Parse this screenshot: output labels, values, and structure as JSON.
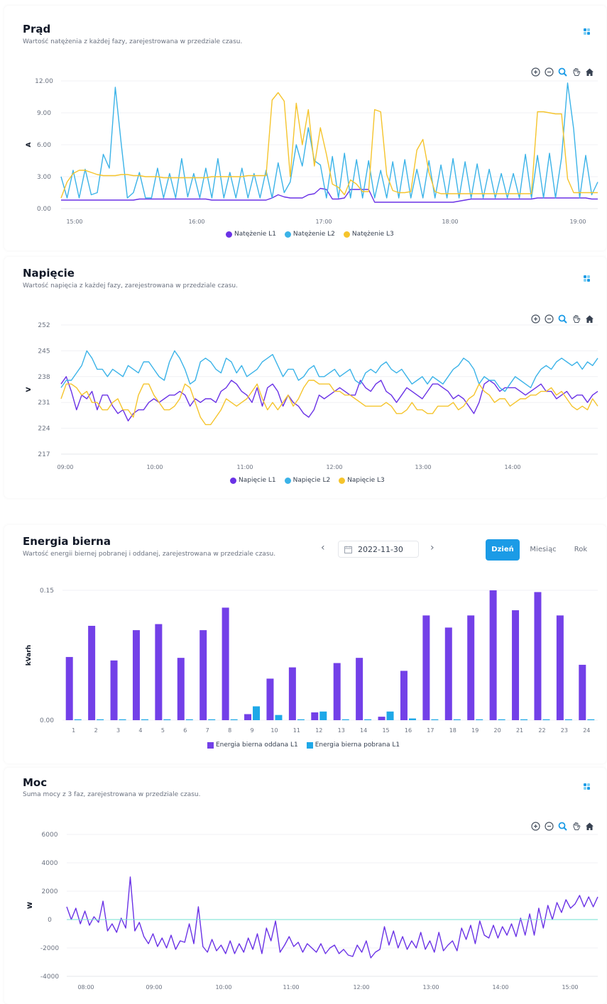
{
  "colors": {
    "l1": "#6a32e6",
    "l2": "#3bb3e8",
    "l3": "#f5c42c",
    "bar_out": "#7340e8",
    "bar_in": "#1ea8e8",
    "zero": "#6fe0d0",
    "accent": "#1b9be6"
  },
  "current": {
    "title": "Prąd",
    "subtitle": "Wartość natężenia z każdej fazy, zarejestrowana w przedziale czasu.",
    "legend": [
      "Natężenie L1",
      "Natężenie L2",
      "Natężenie L3"
    ]
  },
  "voltage": {
    "title": "Napięcie",
    "subtitle": "Wartość napięcia z każdej fazy, zarejestrowana w przedziale czasu.",
    "legend": [
      "Napięcie L1",
      "Napięcie L2",
      "Napięcie L3"
    ]
  },
  "reactive": {
    "title": "Energia bierna",
    "subtitle": "Wartość energii biernej pobranej i oddanej, zarejestrowana w przedziale czasu.",
    "date": "2022-11-30",
    "tabs": [
      "Dzień",
      "Miesiąc",
      "Rok"
    ],
    "legend": [
      "Energia bierna oddana L1",
      "Energia bierna pobrana L1"
    ]
  },
  "power": {
    "title": "Moc",
    "subtitle": "Suma mocy z 3 faz, zarejestrowana w przedziale czasu."
  },
  "toolbar_icons": [
    "zoom-in-icon",
    "zoom-out-icon",
    "magnify-icon",
    "pan-hand-icon",
    "home-icon"
  ],
  "chart_data": [
    {
      "type": "line",
      "ylabel": "A",
      "ylim": [
        0,
        12
      ],
      "yticks": [
        "12.00",
        "9.00",
        "6.00",
        "3.00",
        "0.00"
      ],
      "xticks": [
        "15:00",
        "16:00",
        "17:00",
        "18:00",
        "19:00"
      ],
      "x_range": [
        "14:52",
        "19:10"
      ],
      "series": [
        {
          "name": "Natężenie L1",
          "color": "#6a32e6",
          "values": [
            0.8,
            0.8,
            0.8,
            0.8,
            0.8,
            0.8,
            0.8,
            0.8,
            0.8,
            0.8,
            0.8,
            0.8,
            0.8,
            0.9,
            0.9,
            0.9,
            0.9,
            0.9,
            0.9,
            0.9,
            0.9,
            0.9,
            0.9,
            0.9,
            0.9,
            0.8,
            0.8,
            0.8,
            0.8,
            0.8,
            0.8,
            0.8,
            0.8,
            0.8,
            0.8,
            1.0,
            1.3,
            1.1,
            1.0,
            1.0,
            1.0,
            1.3,
            1.4,
            1.9,
            1.8,
            0.9,
            0.9,
            1.0,
            1.8,
            1.8,
            1.8,
            1.8,
            0.6,
            0.6,
            0.6,
            0.6,
            0.6,
            0.6,
            0.6,
            0.6,
            0.6,
            0.6,
            0.6,
            0.6,
            0.6,
            0.6,
            0.7,
            0.8,
            0.9,
            0.9,
            0.9,
            0.9,
            0.9,
            0.9,
            0.9,
            0.9,
            0.9,
            0.9,
            0.9,
            1.0,
            1.0,
            1.0,
            1.0,
            1.0,
            1.0,
            1.0,
            1.0,
            1.0,
            0.9,
            0.9
          ]
        },
        {
          "name": "Natężenie L2",
          "color": "#3bb3e8",
          "values": [
            3.0,
            1.0,
            3.6,
            1.0,
            3.7,
            1.3,
            1.5,
            5.1,
            3.8,
            11.4,
            6.0,
            1.0,
            1.5,
            3.4,
            1.0,
            1.0,
            3.8,
            1.0,
            3.3,
            1.0,
            4.7,
            1.1,
            3.3,
            1.0,
            3.8,
            1.0,
            4.7,
            1.0,
            3.4,
            1.0,
            3.8,
            1.0,
            3.3,
            1.0,
            3.6,
            1.0,
            4.3,
            1.5,
            2.5,
            6.0,
            4.0,
            7.6,
            4.5,
            4.1,
            1.0,
            4.9,
            1.0,
            5.2,
            1.0,
            4.6,
            1.0,
            4.5,
            1.0,
            3.6,
            1.0,
            4.4,
            1.0,
            4.6,
            1.0,
            3.7,
            1.0,
            4.5,
            1.0,
            4.1,
            1.0,
            4.7,
            1.0,
            4.4,
            1.0,
            4.2,
            1.0,
            3.7,
            1.0,
            3.3,
            1.0,
            3.3,
            1.0,
            5.1,
            1.0,
            5.0,
            1.0,
            5.2,
            1.0,
            4.8,
            11.8,
            7.5,
            1.0,
            5.0,
            1.3,
            2.5
          ]
        },
        {
          "name": "Natężenie L3",
          "color": "#f5c42c",
          "values": [
            1.0,
            2.5,
            3.3,
            3.6,
            3.6,
            3.4,
            3.2,
            3.1,
            3.1,
            3.1,
            3.2,
            3.2,
            3.1,
            3.1,
            3.0,
            3.0,
            3.0,
            2.9,
            2.9,
            2.9,
            2.9,
            2.9,
            2.9,
            2.9,
            2.9,
            3.0,
            3.0,
            3.0,
            3.0,
            3.0,
            3.0,
            3.1,
            3.1,
            3.1,
            3.1,
            10.2,
            10.9,
            10.1,
            3.0,
            9.9,
            6.0,
            9.3,
            4.0,
            7.6,
            5.1,
            2.3,
            2.0,
            1.3,
            2.7,
            2.3,
            1.6,
            1.6,
            9.3,
            9.1,
            3.2,
            1.7,
            1.5,
            1.5,
            1.6,
            5.5,
            6.5,
            3.4,
            1.6,
            1.4,
            1.4,
            1.4,
            1.4,
            1.4,
            1.4,
            1.4,
            1.4,
            1.4,
            1.4,
            1.4,
            1.4,
            1.4,
            1.4,
            1.4,
            1.4,
            9.1,
            9.1,
            9.0,
            8.9,
            8.9,
            2.8,
            1.5,
            1.5,
            1.5,
            1.5,
            1.5
          ]
        }
      ]
    },
    {
      "type": "line",
      "ylabel": "V",
      "ylim": [
        217,
        252
      ],
      "yticks": [
        "252",
        "245",
        "238",
        "231",
        "224",
        "217"
      ],
      "xticks": [
        "09:00",
        "10:00",
        "11:00",
        "12:00",
        "13:00",
        "14:00"
      ],
      "x_range": [
        "08:53",
        "14:55"
      ],
      "series": [
        {
          "name": "Napięcie L1",
          "color": "#6a32e6",
          "values": [
            236,
            238,
            234,
            229,
            233,
            232,
            234,
            229,
            233,
            233,
            230,
            228,
            229,
            226,
            228,
            229,
            229,
            231,
            232,
            231,
            232,
            233,
            233,
            234,
            233,
            230,
            232,
            231,
            232,
            232,
            231,
            234,
            235,
            237,
            236,
            234,
            233,
            231,
            235,
            230,
            235,
            236,
            234,
            230,
            233,
            231,
            230,
            228,
            227,
            229,
            233,
            232,
            233,
            234,
            235,
            234,
            233,
            233,
            237,
            235,
            234,
            236,
            237,
            234,
            233,
            231,
            233,
            235,
            234,
            233,
            232,
            234,
            236,
            236,
            235,
            234,
            232,
            233,
            232,
            230,
            228,
            231,
            236,
            237,
            236,
            234,
            235,
            235,
            235,
            234,
            233,
            234,
            235,
            236,
            234,
            234,
            232,
            233,
            234,
            232,
            233,
            233,
            231,
            233,
            234
          ]
        },
        {
          "name": "Napięcie L2",
          "color": "#3bb3e8",
          "values": [
            235,
            237,
            237,
            239,
            241,
            245,
            243,
            240,
            240,
            238,
            240,
            239,
            238,
            241,
            240,
            239,
            242,
            242,
            240,
            238,
            237,
            242,
            245,
            243,
            240,
            236,
            237,
            242,
            243,
            242,
            240,
            239,
            243,
            242,
            239,
            241,
            238,
            239,
            240,
            242,
            243,
            244,
            241,
            238,
            240,
            240,
            237,
            238,
            240,
            241,
            238,
            238,
            239,
            240,
            238,
            239,
            240,
            237,
            236,
            239,
            240,
            239,
            241,
            242,
            240,
            239,
            240,
            238,
            236,
            237,
            238,
            236,
            238,
            237,
            236,
            238,
            240,
            241,
            243,
            242,
            240,
            236,
            238,
            237,
            237,
            235,
            234,
            236,
            238,
            237,
            236,
            235,
            238,
            240,
            241,
            240,
            242,
            243,
            242,
            241,
            242,
            240,
            242,
            241,
            243
          ]
        },
        {
          "name": "Napięcie L3",
          "color": "#f5c42c",
          "values": [
            232,
            236,
            236,
            235,
            233,
            234,
            231,
            231,
            229,
            229,
            231,
            232,
            229,
            229,
            227,
            233,
            236,
            236,
            233,
            231,
            229,
            229,
            230,
            232,
            236,
            235,
            231,
            227,
            225,
            225,
            227,
            229,
            232,
            231,
            230,
            231,
            232,
            234,
            236,
            232,
            229,
            231,
            229,
            231,
            233,
            230,
            232,
            235,
            237,
            237,
            236,
            236,
            236,
            234,
            234,
            233,
            233,
            232,
            231,
            230,
            230,
            230,
            230,
            231,
            230,
            228,
            228,
            229,
            231,
            229,
            229,
            228,
            228,
            230,
            230,
            230,
            231,
            229,
            230,
            232,
            233,
            236,
            234,
            233,
            231,
            232,
            232,
            230,
            231,
            232,
            232,
            233,
            233,
            234,
            234,
            235,
            233,
            234,
            232,
            230,
            229,
            230,
            229,
            232,
            230
          ]
        }
      ]
    },
    {
      "type": "bar",
      "ylabel": "kVarh",
      "ylim": [
        0,
        0.15
      ],
      "yticks": [
        "0.15",
        "0.00"
      ],
      "categories": [
        "1",
        "2",
        "3",
        "4",
        "5",
        "6",
        "7",
        "8",
        "9",
        "10",
        "11",
        "12",
        "13",
        "14",
        "15",
        "16",
        "17",
        "18",
        "19",
        "20",
        "21",
        "22",
        "23",
        "24"
      ],
      "series": [
        {
          "name": "Energia bierna oddana L1",
          "color": "#7340e8",
          "values": [
            0.073,
            0.109,
            0.069,
            0.104,
            0.111,
            0.072,
            0.104,
            0.13,
            0.007,
            0.048,
            0.061,
            0.009,
            0.066,
            0.072,
            0.004,
            0.057,
            0.121,
            0.107,
            0.121,
            0.15,
            0.127,
            0.148,
            0.121,
            0.064
          ]
        },
        {
          "name": "Energia bierna pobrana L1",
          "color": "#1ea8e8",
          "values": [
            0.001,
            0.001,
            0.001,
            0.001,
            0.001,
            0.001,
            0.001,
            0.001,
            0.016,
            0.006,
            0.001,
            0.01,
            0.001,
            0.001,
            0.01,
            0.002,
            0.001,
            0.001,
            0.001,
            0.001,
            0.001,
            0.001,
            0.001,
            0.001
          ]
        }
      ]
    },
    {
      "type": "line",
      "ylabel": "W",
      "ylim": [
        -4000,
        6000
      ],
      "yticks": [
        "6000",
        "4000",
        "2000",
        "0",
        "-2000",
        "-4000"
      ],
      "xticks": [
        "08:00",
        "09:00",
        "10:00",
        "11:00",
        "12:00",
        "13:00",
        "14:00",
        "15:00"
      ],
      "x_range": [
        "07:50",
        "15:25"
      ],
      "series": [
        {
          "name": "Moc",
          "color": "#6a32e6",
          "values": [
            900,
            0,
            800,
            -300,
            600,
            -400,
            200,
            -200,
            1300,
            -800,
            -300,
            -900,
            100,
            -600,
            3000,
            -800,
            -200,
            -1200,
            -1700,
            -1000,
            -1900,
            -1300,
            -2000,
            -1100,
            -2100,
            -1500,
            -1600,
            -300,
            -1700,
            900,
            -1900,
            -2300,
            -1400,
            -2200,
            -1800,
            -2400,
            -1500,
            -2400,
            -1700,
            -2300,
            -1300,
            -2100,
            -1000,
            -2400,
            -600,
            -1500,
            -100,
            -2300,
            -1800,
            -1200,
            -1900,
            -1600,
            -2300,
            -1700,
            -2000,
            -2300,
            -1700,
            -2400,
            -2000,
            -1800,
            -2400,
            -2100,
            -2500,
            -2600,
            -1800,
            -2300,
            -1500,
            -2700,
            -2300,
            -2100,
            -500,
            -1800,
            -800,
            -2000,
            -1200,
            -2100,
            -1500,
            -2000,
            -900,
            -2100,
            -1500,
            -2300,
            -900,
            -2200,
            -1800,
            -1500,
            -2200,
            -600,
            -1400,
            -400,
            -1700,
            -100,
            -1100,
            -1300,
            -400,
            -1300,
            -500,
            -1100,
            -300,
            -1200,
            100,
            -1100,
            400,
            -1100,
            800,
            -600,
            1000,
            0,
            1200,
            500,
            1400,
            800,
            1100,
            1700,
            900,
            1600,
            900,
            1600
          ]
        },
        {
          "name": "zero",
          "color": "#6fe0d0",
          "values": [
            0,
            0
          ]
        }
      ]
    }
  ]
}
